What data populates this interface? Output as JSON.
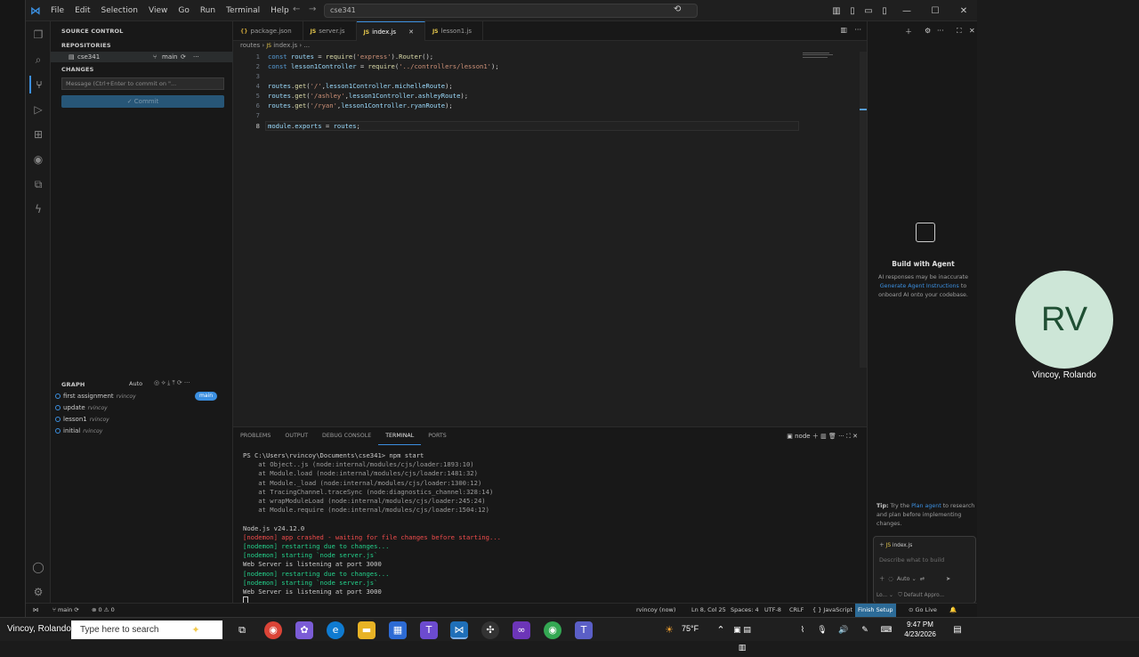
{
  "titlebar": {
    "menus": [
      "File",
      "Edit",
      "Selection",
      "View",
      "Go",
      "Run",
      "Terminal",
      "Help"
    ],
    "search": "cse341"
  },
  "sidebar": {
    "title": "SOURCE CONTROL",
    "repositories_label": "REPOSITORIES",
    "repo": {
      "name": "cse341",
      "branch": "main"
    },
    "changes_label": "CHANGES",
    "commit_placeholder": "Message (Ctrl+Enter to commit on \"...",
    "commit_button": "Commit",
    "graph_label": "GRAPH",
    "graph_auto": "Auto",
    "graph": [
      {
        "message": "first assignment",
        "author": "rvincoy",
        "badge": "main"
      },
      {
        "message": "update",
        "author": "rvincoy"
      },
      {
        "message": "lesson1",
        "author": "rvincoy"
      },
      {
        "message": "initial",
        "author": "rvincoy"
      }
    ]
  },
  "editor": {
    "tabs": [
      {
        "icon": "{}",
        "label": "package.json"
      },
      {
        "icon": "JS",
        "label": "server.js"
      },
      {
        "icon": "JS",
        "label": "index.js",
        "active": true
      },
      {
        "icon": "JS",
        "label": "lesson1.js"
      }
    ],
    "breadcrumb": [
      "routes",
      "index.js",
      "..."
    ],
    "lines": [
      {
        "n": "1",
        "code": "const routes = require('express').Router();"
      },
      {
        "n": "2",
        "code": "const lesson1Controller = require('../controllers/lesson1');"
      },
      {
        "n": "3",
        "code": ""
      },
      {
        "n": "4",
        "code": "routes.get('/',lesson1Controller.michelleRoute);"
      },
      {
        "n": "5",
        "code": "routes.get('/ashley',lesson1Controller.ashleyRoute);"
      },
      {
        "n": "6",
        "code": "routes.get('/ryan',lesson1Controller.ryanRoute);"
      },
      {
        "n": "7",
        "code": ""
      },
      {
        "n": "8",
        "code": "module.exports = routes;"
      }
    ]
  },
  "panel": {
    "tabs": [
      "PROBLEMS",
      "OUTPUT",
      "DEBUG CONSOLE",
      "TERMINAL",
      "PORTS"
    ],
    "active_tab": "TERMINAL",
    "shell": "node",
    "terminal": [
      {
        "text": "PS C:\\Users\\rvincoy\\Documents\\cse341> npm start",
        "color": "white"
      },
      {
        "text": "    at Object..js (node:internal/modules/cjs/loader:1893:10)",
        "color": "dim"
      },
      {
        "text": "    at Module.load (node:internal/modules/cjs/loader:1481:32)",
        "color": "dim"
      },
      {
        "text": "    at Module._load (node:internal/modules/cjs/loader:1300:12)",
        "color": "dim"
      },
      {
        "text": "    at TracingChannel.traceSync (node:diagnostics_channel:328:14)",
        "color": "dim"
      },
      {
        "text": "    at wrapModuleLoad (node:internal/modules/cjs/loader:245:24)",
        "color": "dim"
      },
      {
        "text": "    at Module.require (node:internal/modules/cjs/loader:1504:12)",
        "color": "dim"
      },
      {
        "text": "",
        "color": "dim"
      },
      {
        "text": "Node.js v24.12.0",
        "color": "white"
      },
      {
        "text": "[nodemon] app crashed - waiting for file changes before starting...",
        "color": "red"
      },
      {
        "text": "[nodemon] restarting due to changes...",
        "color": "green"
      },
      {
        "text": "[nodemon] starting `node server.js`",
        "color": "green"
      },
      {
        "text": "Web Server is listening at port 3000",
        "color": "white"
      },
      {
        "text": "[nodemon] restarting due to changes...",
        "color": "green"
      },
      {
        "text": "[nodemon] starting `node server.js`",
        "color": "green"
      },
      {
        "text": "Web Server is listening at port 3000",
        "color": "white"
      }
    ]
  },
  "chat": {
    "title": "Build with Agent",
    "line1": "AI responses may be inaccurate",
    "link": "Generate Agent Instructions",
    "line2": "to onboard AI onto your codebase.",
    "tip_prefix": "Tip:",
    "tip_text1": "Try the",
    "tip_link": "Plan agent",
    "tip_text2": "to research and plan before implementing changes.",
    "context_file": "index.js",
    "placeholder": "Describe what to build",
    "mode": "Auto",
    "footer_left": "Lo...",
    "footer_right": "Default Appro..."
  },
  "statusbar": {
    "branch": "main",
    "problems": "0",
    "warnings": "0",
    "author": "rvincoy (now)",
    "position": "Ln 8, Col 25",
    "spaces": "Spaces: 4",
    "encoding": "UTF-8",
    "eol": "CRLF",
    "language": "JavaScript",
    "finish_setup": "Finish Setup",
    "go_live": "Go Live"
  },
  "participant": {
    "initials": "RV",
    "name": "Vincoy, Rolando"
  },
  "taskbar": {
    "search": "Type here to search",
    "temperature": "75°F",
    "time": "9:47 PM",
    "date": "4/23/2026"
  },
  "overlay_name": "Vincoy, Rolando",
  "colors": {
    "accent": "#3b8fe0",
    "status_accent": "#2c6b97",
    "error": "#f14c4c",
    "success": "#23d18b"
  }
}
